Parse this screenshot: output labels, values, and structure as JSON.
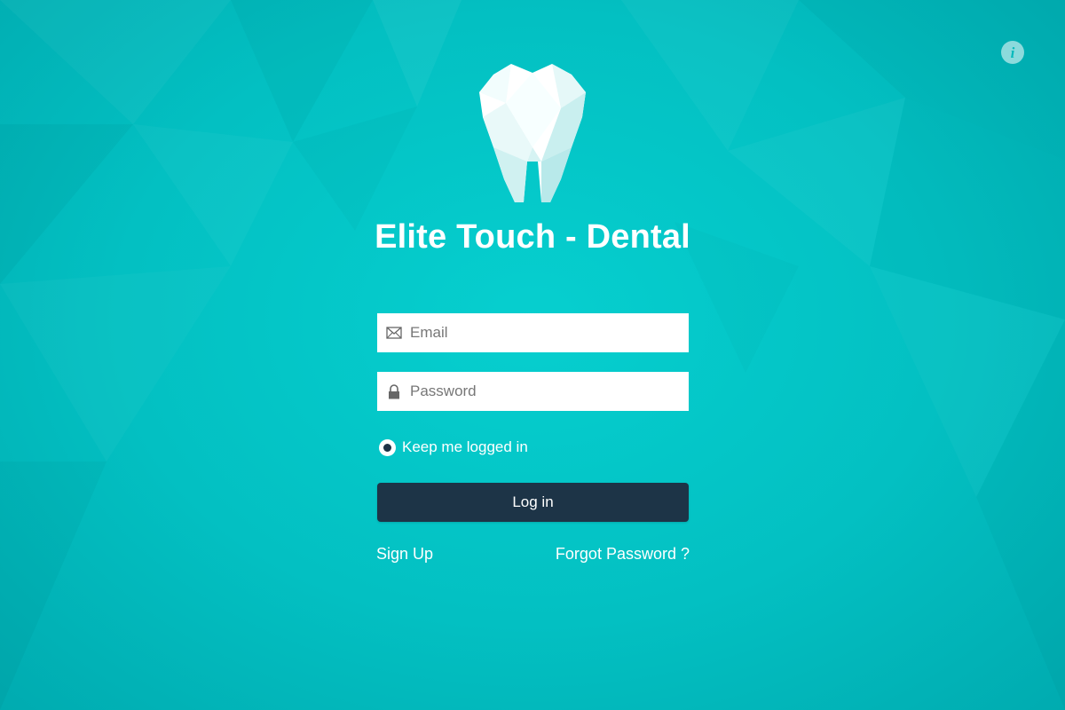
{
  "app": {
    "title": "Elite Touch - Dental",
    "logo_icon": "tooth-logo-icon",
    "info_icon": "info-icon",
    "info_glyph": "i"
  },
  "login": {
    "email": {
      "placeholder": "Email",
      "value": "",
      "icon": "envelope-icon"
    },
    "password": {
      "placeholder": "Password",
      "value": "",
      "icon": "lock-icon"
    },
    "keep_logged_in": {
      "label": "Keep me logged in",
      "checked": true
    },
    "submit_label": "Log in",
    "signup_label": "Sign Up",
    "forgot_label": "Forgot Password ?"
  },
  "colors": {
    "background": "#04c4c5",
    "button": "#1d3447",
    "text": "#ffffff"
  }
}
